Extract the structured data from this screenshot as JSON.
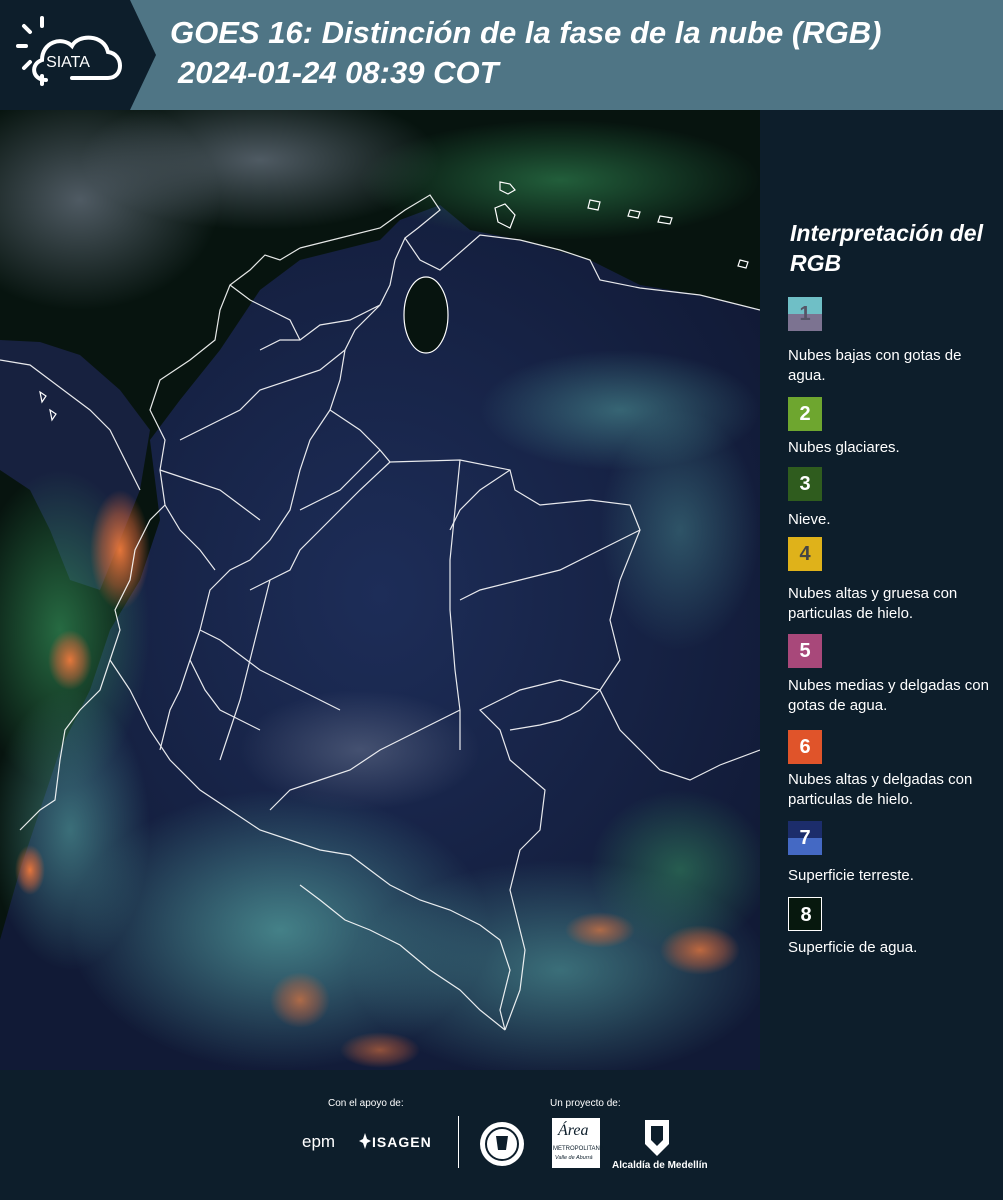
{
  "header": {
    "logo_text": "SIATA",
    "title": "GOES 16: Distinción de la fase de la nube (RGB)",
    "subtitle": "2024-01-24 08:39 COT"
  },
  "legend": {
    "title": "Interpretación del RGB",
    "items": [
      {
        "num": "1",
        "text": "Nubes bajas con gotas de agua.",
        "colors": [
          "#6fbfc6",
          "#7c7391"
        ],
        "num_color": "#555566"
      },
      {
        "num": "2",
        "text": "Nubes glaciares.",
        "colors": [
          "#6ea62f"
        ],
        "num_color": "#ffffff"
      },
      {
        "num": "3",
        "text": "Nieve.",
        "colors": [
          "#2f5c1e"
        ],
        "num_color": "#ffffff"
      },
      {
        "num": "4",
        "text": "Nubes altas y gruesa con particulas de hielo.",
        "colors": [
          "#dfb21a"
        ],
        "num_color": "#444444"
      },
      {
        "num": "5",
        "text": "Nubes medias y delgadas con gotas de agua.",
        "colors": [
          "#a8487a"
        ],
        "num_color": "#ffffff"
      },
      {
        "num": "6",
        "text": "Nubes altas y delgadas con particulas de hielo.",
        "colors": [
          "#e0542a"
        ],
        "num_color": "#ffffff"
      },
      {
        "num": "7",
        "text": "Superficie terreste.",
        "colors": [
          "#1c2d6b",
          "#4469c4"
        ],
        "num_color": "#ffffff"
      },
      {
        "num": "8",
        "text": "Superficie de agua.",
        "colors": [
          "#07180e"
        ],
        "num_color": "#ffffff"
      }
    ]
  },
  "footer": {
    "support_label": "Con el apoyo de:",
    "project_label": "Un proyecto de:",
    "sponsors": [
      "epm",
      "ISAGEN"
    ],
    "area_logo_text": "Área",
    "area_logo_sub": "METROPOLITANA",
    "area_logo_sub2": "Valle de Aburrá",
    "alcaldia": "Alcaldía de Medellín"
  },
  "colors": {
    "header_bg": "#4f7585",
    "page_bg": "#0d1e2b"
  }
}
